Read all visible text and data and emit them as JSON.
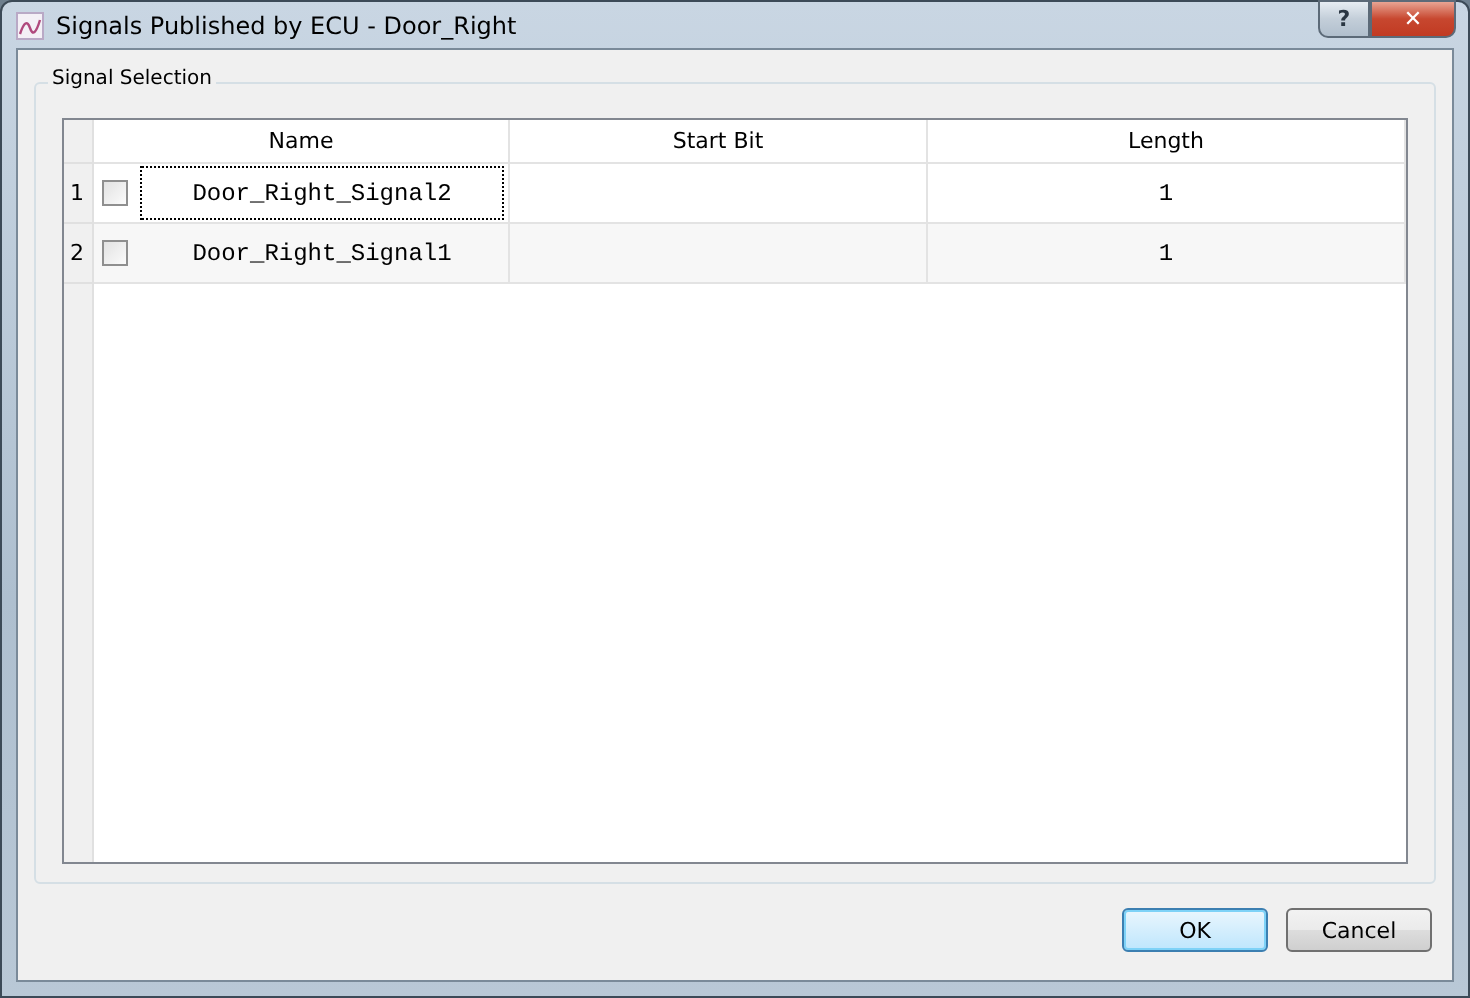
{
  "window": {
    "title": "Signals Published by ECU - Door_Right",
    "help_button": "?",
    "close_button": "✕"
  },
  "group": {
    "title": "Signal Selection"
  },
  "table": {
    "columns": [
      "Name",
      "Start Bit",
      "Length"
    ],
    "rows": [
      {
        "number": "1",
        "checked": false,
        "focused": true,
        "name": "Door_Right_Signal2",
        "start_bit": "",
        "length": "1"
      },
      {
        "number": "2",
        "checked": false,
        "focused": false,
        "name": "Door_Right_Signal1",
        "start_bit": "",
        "length": "1"
      }
    ]
  },
  "buttons": [
    {
      "label": "OK",
      "default": true
    },
    {
      "label": "Cancel",
      "default": false
    }
  ]
}
